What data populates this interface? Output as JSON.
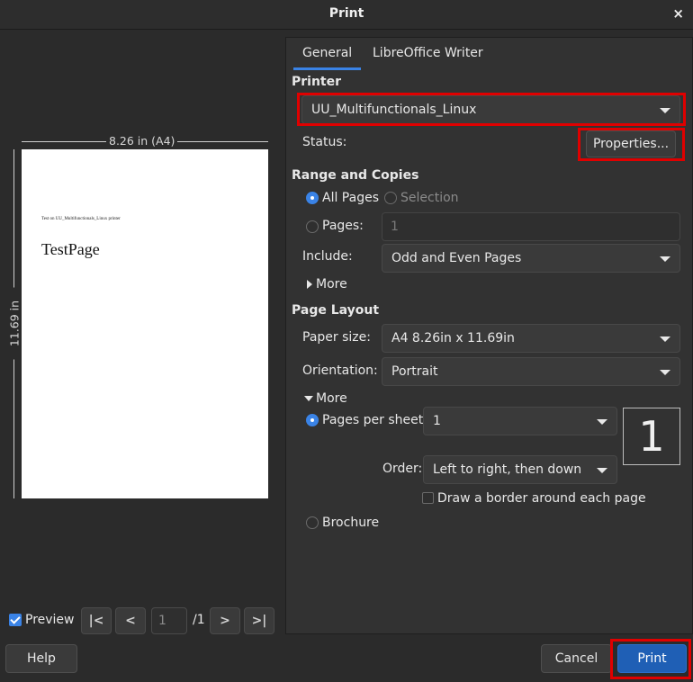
{
  "window": {
    "title": "Print",
    "close_glyph": "×"
  },
  "preview": {
    "width_label": "8.26 in (A4)",
    "height_label": "11.69 in",
    "page_small_text": "Test on UU_Multifunctionals_Linux printer",
    "page_big_text": "TestPage",
    "preview_label": "Preview",
    "preview_checked": true,
    "current_page": "1",
    "total_pages": "/1",
    "nav_first": "|<",
    "nav_prev": "<",
    "nav_next": ">",
    "nav_last": ">|"
  },
  "tabs": [
    "General",
    "LibreOffice Writer"
  ],
  "printer": {
    "heading": "Printer",
    "selected": "UU_Multifunctionals_Linux",
    "status_label": "Status:",
    "properties_button": "Properties..."
  },
  "range": {
    "heading": "Range and Copies",
    "all_pages": "All Pages",
    "selection": "Selection",
    "pages_label": "Pages:",
    "pages_value": "1",
    "include_label": "Include:",
    "include_value": "Odd and Even Pages",
    "more": "More"
  },
  "layout": {
    "heading": "Page Layout",
    "paper_size_label": "Paper size:",
    "paper_size_value": "A4 8.26in x 11.69in",
    "orientation_label": "Orientation:",
    "orientation_value": "Portrait",
    "more": "More",
    "pps_label": "Pages per sheet:",
    "pps_value": "1",
    "pps_preview": "1",
    "order_label": "Order:",
    "order_value": "Left to right, then down",
    "border_label": "Draw a border around each page",
    "brochure_label": "Brochure"
  },
  "buttons": {
    "help": "Help",
    "cancel": "Cancel",
    "print": "Print"
  },
  "colors": {
    "accent": "#3a83e6",
    "highlight": "#e00000",
    "print_button": "#1f5fb5"
  }
}
